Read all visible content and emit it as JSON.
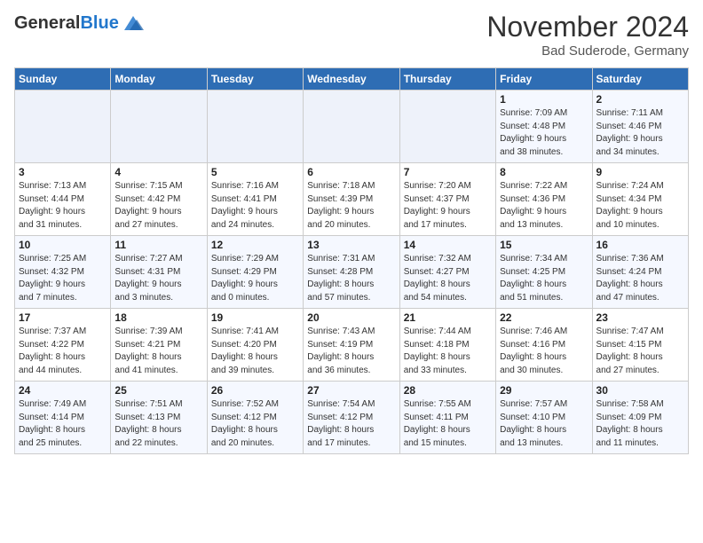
{
  "header": {
    "logo_general": "General",
    "logo_blue": "Blue",
    "month_title": "November 2024",
    "location": "Bad Suderode, Germany"
  },
  "days_of_week": [
    "Sunday",
    "Monday",
    "Tuesday",
    "Wednesday",
    "Thursday",
    "Friday",
    "Saturday"
  ],
  "weeks": [
    [
      {
        "day": "",
        "info": ""
      },
      {
        "day": "",
        "info": ""
      },
      {
        "day": "",
        "info": ""
      },
      {
        "day": "",
        "info": ""
      },
      {
        "day": "",
        "info": ""
      },
      {
        "day": "1",
        "info": "Sunrise: 7:09 AM\nSunset: 4:48 PM\nDaylight: 9 hours\nand 38 minutes."
      },
      {
        "day": "2",
        "info": "Sunrise: 7:11 AM\nSunset: 4:46 PM\nDaylight: 9 hours\nand 34 minutes."
      }
    ],
    [
      {
        "day": "3",
        "info": "Sunrise: 7:13 AM\nSunset: 4:44 PM\nDaylight: 9 hours\nand 31 minutes."
      },
      {
        "day": "4",
        "info": "Sunrise: 7:15 AM\nSunset: 4:42 PM\nDaylight: 9 hours\nand 27 minutes."
      },
      {
        "day": "5",
        "info": "Sunrise: 7:16 AM\nSunset: 4:41 PM\nDaylight: 9 hours\nand 24 minutes."
      },
      {
        "day": "6",
        "info": "Sunrise: 7:18 AM\nSunset: 4:39 PM\nDaylight: 9 hours\nand 20 minutes."
      },
      {
        "day": "7",
        "info": "Sunrise: 7:20 AM\nSunset: 4:37 PM\nDaylight: 9 hours\nand 17 minutes."
      },
      {
        "day": "8",
        "info": "Sunrise: 7:22 AM\nSunset: 4:36 PM\nDaylight: 9 hours\nand 13 minutes."
      },
      {
        "day": "9",
        "info": "Sunrise: 7:24 AM\nSunset: 4:34 PM\nDaylight: 9 hours\nand 10 minutes."
      }
    ],
    [
      {
        "day": "10",
        "info": "Sunrise: 7:25 AM\nSunset: 4:32 PM\nDaylight: 9 hours\nand 7 minutes."
      },
      {
        "day": "11",
        "info": "Sunrise: 7:27 AM\nSunset: 4:31 PM\nDaylight: 9 hours\nand 3 minutes."
      },
      {
        "day": "12",
        "info": "Sunrise: 7:29 AM\nSunset: 4:29 PM\nDaylight: 9 hours\nand 0 minutes."
      },
      {
        "day": "13",
        "info": "Sunrise: 7:31 AM\nSunset: 4:28 PM\nDaylight: 8 hours\nand 57 minutes."
      },
      {
        "day": "14",
        "info": "Sunrise: 7:32 AM\nSunset: 4:27 PM\nDaylight: 8 hours\nand 54 minutes."
      },
      {
        "day": "15",
        "info": "Sunrise: 7:34 AM\nSunset: 4:25 PM\nDaylight: 8 hours\nand 51 minutes."
      },
      {
        "day": "16",
        "info": "Sunrise: 7:36 AM\nSunset: 4:24 PM\nDaylight: 8 hours\nand 47 minutes."
      }
    ],
    [
      {
        "day": "17",
        "info": "Sunrise: 7:37 AM\nSunset: 4:22 PM\nDaylight: 8 hours\nand 44 minutes."
      },
      {
        "day": "18",
        "info": "Sunrise: 7:39 AM\nSunset: 4:21 PM\nDaylight: 8 hours\nand 41 minutes."
      },
      {
        "day": "19",
        "info": "Sunrise: 7:41 AM\nSunset: 4:20 PM\nDaylight: 8 hours\nand 39 minutes."
      },
      {
        "day": "20",
        "info": "Sunrise: 7:43 AM\nSunset: 4:19 PM\nDaylight: 8 hours\nand 36 minutes."
      },
      {
        "day": "21",
        "info": "Sunrise: 7:44 AM\nSunset: 4:18 PM\nDaylight: 8 hours\nand 33 minutes."
      },
      {
        "day": "22",
        "info": "Sunrise: 7:46 AM\nSunset: 4:16 PM\nDaylight: 8 hours\nand 30 minutes."
      },
      {
        "day": "23",
        "info": "Sunrise: 7:47 AM\nSunset: 4:15 PM\nDaylight: 8 hours\nand 27 minutes."
      }
    ],
    [
      {
        "day": "24",
        "info": "Sunrise: 7:49 AM\nSunset: 4:14 PM\nDaylight: 8 hours\nand 25 minutes."
      },
      {
        "day": "25",
        "info": "Sunrise: 7:51 AM\nSunset: 4:13 PM\nDaylight: 8 hours\nand 22 minutes."
      },
      {
        "day": "26",
        "info": "Sunrise: 7:52 AM\nSunset: 4:12 PM\nDaylight: 8 hours\nand 20 minutes."
      },
      {
        "day": "27",
        "info": "Sunrise: 7:54 AM\nSunset: 4:12 PM\nDaylight: 8 hours\nand 17 minutes."
      },
      {
        "day": "28",
        "info": "Sunrise: 7:55 AM\nSunset: 4:11 PM\nDaylight: 8 hours\nand 15 minutes."
      },
      {
        "day": "29",
        "info": "Sunrise: 7:57 AM\nSunset: 4:10 PM\nDaylight: 8 hours\nand 13 minutes."
      },
      {
        "day": "30",
        "info": "Sunrise: 7:58 AM\nSunset: 4:09 PM\nDaylight: 8 hours\nand 11 minutes."
      }
    ]
  ]
}
